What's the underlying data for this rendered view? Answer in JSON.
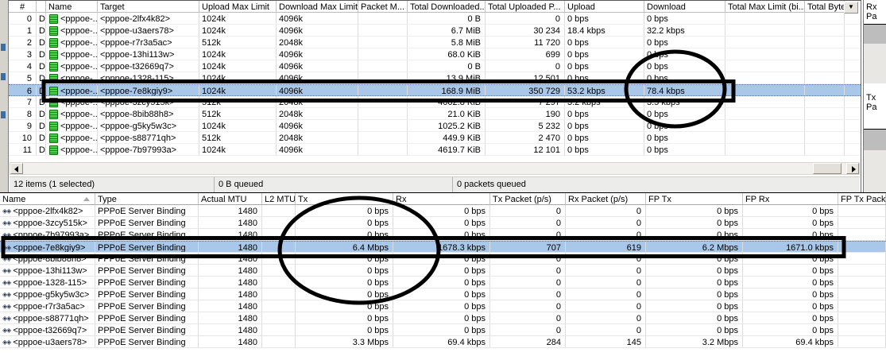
{
  "queue_window": {
    "headers": [
      "#",
      "",
      "Name",
      "Target",
      "Upload Max Limit",
      "Download Max Limit",
      "Packet M...",
      "Total Downloaded...",
      "Total Uploaded P...",
      "Upload",
      "Download",
      "Total Max Limit (bi...",
      "Total Bytes"
    ],
    "rows": [
      {
        "selected": false,
        "cells": [
          "0",
          "D",
          "<pppoe-...",
          "<pppoe-2lfx4k82>",
          "1024k",
          "4096k",
          "",
          "0 B",
          "0",
          "0 bps",
          "0 bps",
          "",
          ""
        ]
      },
      {
        "selected": false,
        "cells": [
          "1",
          "D",
          "<pppoe-...",
          "<pppoe-u3aers78>",
          "1024k",
          "4096k",
          "",
          "6.7 MiB",
          "30 234",
          "18.4 kbps",
          "32.2 kbps",
          "",
          ""
        ]
      },
      {
        "selected": false,
        "cells": [
          "2",
          "D",
          "<pppoe-...",
          "<pppoe-r7r3a5ac>",
          "512k",
          "2048k",
          "",
          "5.8 MiB",
          "11 720",
          "0 bps",
          "0 bps",
          "",
          ""
        ]
      },
      {
        "selected": false,
        "cells": [
          "3",
          "D",
          "<pppoe-...",
          "<pppoe-13hi113w>",
          "1024k",
          "4096k",
          "",
          "68.0 KiB",
          "699",
          "0 bps",
          "0 bps",
          "",
          ""
        ]
      },
      {
        "selected": false,
        "cells": [
          "4",
          "D",
          "<pppoe-...",
          "<pppoe-t32669q7>",
          "1024k",
          "4096k",
          "",
          "0 B",
          "0",
          "0 bps",
          "0 bps",
          "",
          ""
        ]
      },
      {
        "selected": false,
        "cells": [
          "5",
          "D",
          "<pppoe-...",
          "<pppoe-1328-115>",
          "1024k",
          "4096k",
          "",
          "13.9 MiB",
          "12 501",
          "0 bps",
          "0 bps",
          "",
          ""
        ]
      },
      {
        "selected": true,
        "cells": [
          "6",
          "D",
          "<pppoe-...",
          "<pppoe-7e8kgiy9>",
          "1024k",
          "4096k",
          "",
          "168.9 MiB",
          "350 729",
          "53.2 kbps",
          "78.4 kbps",
          "",
          ""
        ]
      },
      {
        "selected": false,
        "cells": [
          "7",
          "D",
          "<pppoe-...",
          "<pppoe-3zcy515k>",
          "512k",
          "2048k",
          "",
          "4002.8 KiB",
          "7 297",
          "3.2 kbps",
          "3.5 kbps",
          "",
          ""
        ]
      },
      {
        "selected": false,
        "cells": [
          "8",
          "D",
          "<pppoe-...",
          "<pppoe-8bib88h8>",
          "512k",
          "2048k",
          "",
          "21.0 KiB",
          "190",
          "0 bps",
          "0 bps",
          "",
          ""
        ]
      },
      {
        "selected": false,
        "cells": [
          "9",
          "D",
          "<pppoe-...",
          "<pppoe-g5ky5w3c>",
          "1024k",
          "4096k",
          "",
          "1025.2 KiB",
          "5 232",
          "0 bps",
          "0 bps",
          "",
          ""
        ]
      },
      {
        "selected": false,
        "cells": [
          "10",
          "D",
          "<pppoe-...",
          "<pppoe-s88771qh>",
          "512k",
          "2048k",
          "",
          "449.9 KiB",
          "2 470",
          "0 bps",
          "0 bps",
          "",
          ""
        ]
      },
      {
        "selected": false,
        "cells": [
          "11",
          "D",
          "<pppoe-...",
          "<pppoe-7b97993a>",
          "1024k",
          "4096k",
          "",
          "4619.7 KiB",
          "12 101",
          "0 bps",
          "0 bps",
          "",
          ""
        ]
      }
    ],
    "status": {
      "items": "12 items (1 selected)",
      "queued_bytes": "0 B queued",
      "queued_packets": "0 packets queued"
    },
    "column_picker_icon": "▼"
  },
  "interfaces_window": {
    "headers": [
      "Name",
      "Type",
      "Actual MTU",
      "L2 MTU",
      "Tx",
      "Rx",
      "Tx Packet (p/s)",
      "Rx Packet (p/s)",
      "FP Tx",
      "FP Rx",
      "FP Tx Packe..."
    ],
    "rows": [
      {
        "selected": false,
        "cells": [
          "<pppoe-2lfx4k82>",
          "PPPoE Server Binding",
          "1480",
          "",
          "0 bps",
          "0 bps",
          "0",
          "0",
          "0 bps",
          "0 bps",
          ""
        ]
      },
      {
        "selected": false,
        "cells": [
          "<pppoe-3zcy515k>",
          "PPPoE Server Binding",
          "1480",
          "",
          "0 bps",
          "0 bps",
          "0",
          "0",
          "0 bps",
          "0 bps",
          ""
        ]
      },
      {
        "selected": false,
        "cells": [
          "<pppoe-7b97993a>",
          "PPPoE Server Binding",
          "1480",
          "",
          "0 bps",
          "0 bps",
          "0",
          "0",
          "0 bps",
          "0 bps",
          ""
        ]
      },
      {
        "selected": true,
        "cells": [
          "<pppoe-7e8kgiy9>",
          "PPPoE Server Binding",
          "1480",
          "",
          "6.4 Mbps",
          "1678.3 kbps",
          "707",
          "619",
          "6.2 Mbps",
          "1671.0 kbps",
          ""
        ]
      },
      {
        "selected": false,
        "cells": [
          "<pppoe-8bib88h8>",
          "PPPoE Server Binding",
          "1480",
          "",
          "0 bps",
          "0 bps",
          "0",
          "0",
          "0 bps",
          "0 bps",
          ""
        ]
      },
      {
        "selected": false,
        "cells": [
          "<pppoe-13hi113w>",
          "PPPoE Server Binding",
          "1480",
          "",
          "0 bps",
          "0 bps",
          "0",
          "0",
          "0 bps",
          "0 bps",
          ""
        ]
      },
      {
        "selected": false,
        "cells": [
          "<pppoe-1328-115>",
          "PPPoE Server Binding",
          "1480",
          "",
          "0 bps",
          "0 bps",
          "0",
          "0",
          "0 bps",
          "0 bps",
          ""
        ]
      },
      {
        "selected": false,
        "cells": [
          "<pppoe-g5ky5w3c>",
          "PPPoE Server Binding",
          "1480",
          "",
          "0 bps",
          "0 bps",
          "0",
          "0",
          "0 bps",
          "0 bps",
          ""
        ]
      },
      {
        "selected": false,
        "cells": [
          "<pppoe-r7r3a5ac>",
          "PPPoE Server Binding",
          "1480",
          "",
          "0 bps",
          "0 bps",
          "0",
          "0",
          "0 bps",
          "0 bps",
          ""
        ]
      },
      {
        "selected": false,
        "cells": [
          "<pppoe-s88771qh>",
          "PPPoE Server Binding",
          "1480",
          "",
          "0 bps",
          "0 bps",
          "0",
          "0",
          "0 bps",
          "0 bps",
          ""
        ]
      },
      {
        "selected": false,
        "cells": [
          "<pppoe-t32669q7>",
          "PPPoE Server Binding",
          "1480",
          "",
          "0 bps",
          "0 bps",
          "0",
          "0",
          "0 bps",
          "0 bps",
          ""
        ]
      },
      {
        "selected": false,
        "cells": [
          "<pppoe-u3aers78>",
          "PPPoE Server Binding",
          "1480",
          "",
          "3.3 Mbps",
          "69.4 kbps",
          "284",
          "145",
          "3.2 Mbps",
          "69.4 kbps",
          ""
        ]
      }
    ]
  },
  "side_panel": {
    "rx_label": "Rx Pa",
    "tx_label": "Tx Pa"
  },
  "icons": {
    "queue_icon": "queue-icon",
    "interface_icon": "◈◈"
  },
  "colors": {
    "selection": "#a9c7e9",
    "annotation": "#000000",
    "queue_icon_green": "#128a12"
  }
}
